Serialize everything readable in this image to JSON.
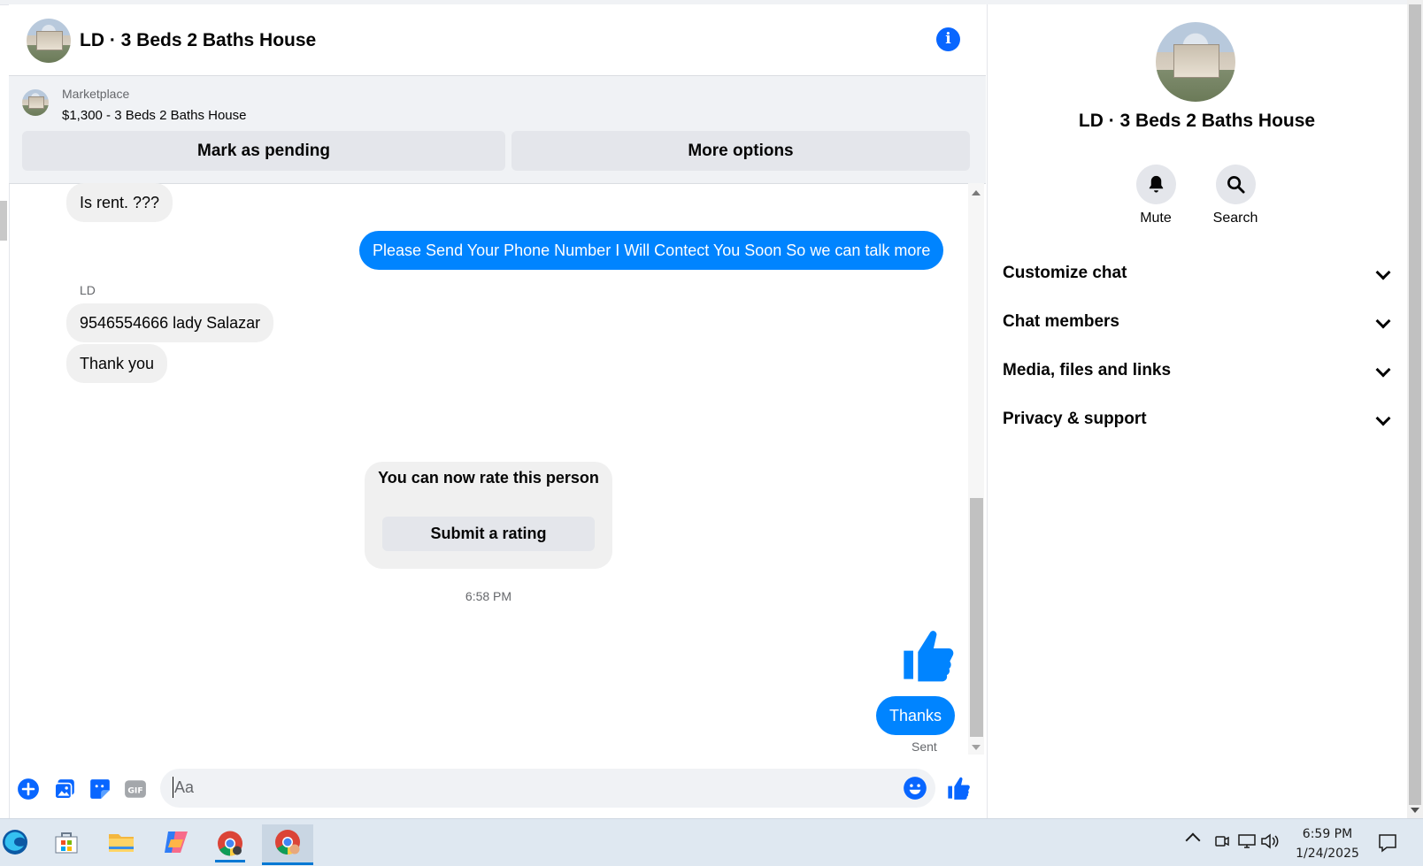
{
  "header": {
    "title": "LD · 3 Beds 2 Baths House",
    "info_icon": "info-icon"
  },
  "marketplace": {
    "label": "Marketplace",
    "listing": "$1,300 - 3 Beds 2 Baths House",
    "mark_pending_label": "Mark as pending",
    "more_options_label": "More options"
  },
  "messages": {
    "m1": "Is rent. ???",
    "m2": "Please Send Your Phone Number I Will Contect You Soon So we can talk more",
    "sender": "LD",
    "m3": "9546554666 lady Salazar",
    "m4": "Thank you",
    "rate_text": "You can now rate this person",
    "rate_button": "Submit a rating",
    "timestamp": "6:58 PM",
    "m5": "Thanks",
    "status": "Sent"
  },
  "composer": {
    "placeholder": "Aa"
  },
  "side": {
    "title": "LD · 3 Beds 2 Baths House",
    "mute_label": "Mute",
    "search_label": "Search",
    "rows": [
      "Customize chat",
      "Chat members",
      "Media, files and links",
      "Privacy & support"
    ]
  },
  "taskbar": {
    "time": "6:59 PM",
    "date": "1/24/2025"
  },
  "colors": {
    "accent": "#0866ff",
    "bubble_out": "#0084ff",
    "bubble_in": "#f0f0f0"
  }
}
